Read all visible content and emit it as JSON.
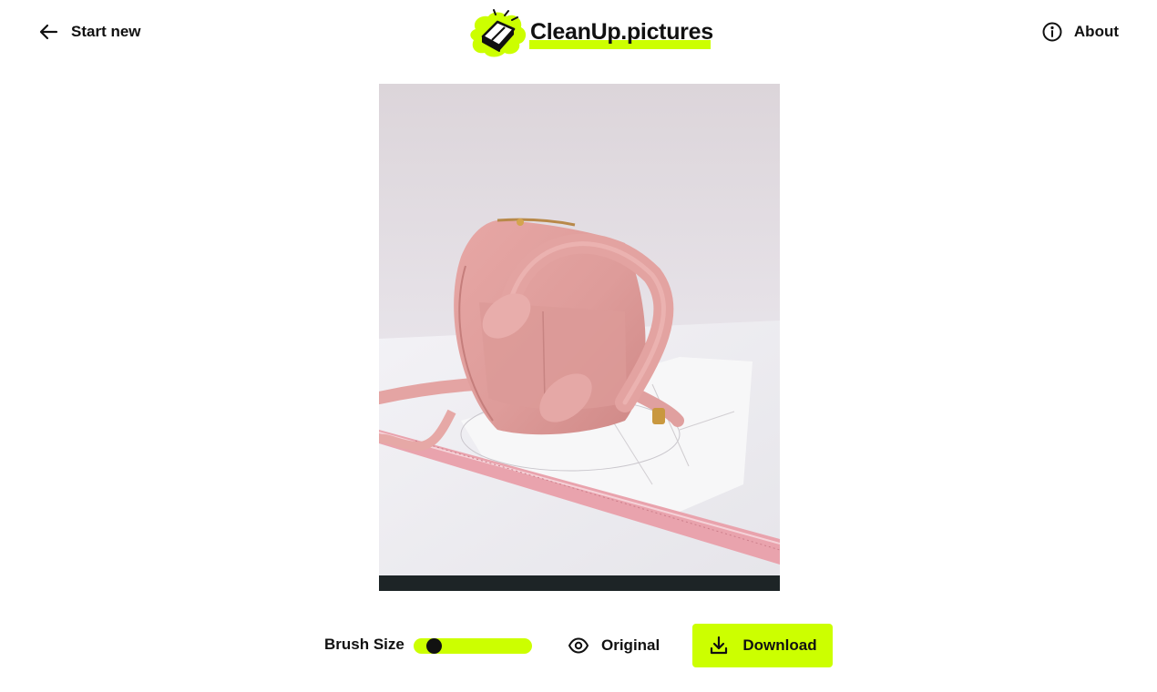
{
  "header": {
    "start_new_label": "Start new",
    "start_new_icon": "arrow-left-icon",
    "about_label": "About",
    "about_icon": "info-circle-icon",
    "logo_text": "CleanUp.pictures",
    "logo_icon": "eraser-icon"
  },
  "toolbar": {
    "brush_size_label": "Brush Size",
    "brush_size_level": 0.12,
    "original_label": "Original",
    "original_icon": "eye-icon",
    "download_label": "Download",
    "download_icon": "download-icon"
  },
  "colors": {
    "accent": "#ccff00",
    "text": "#111111",
    "background": "#ffffff"
  }
}
